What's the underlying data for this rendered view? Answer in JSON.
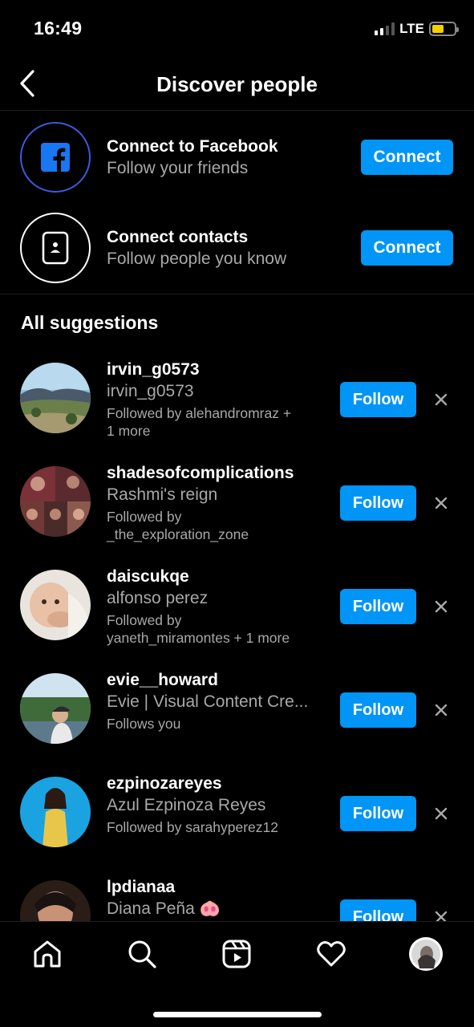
{
  "status_bar": {
    "time": "16:49",
    "network": "LTE",
    "battery_color": "#f5d000"
  },
  "header": {
    "title": "Discover people"
  },
  "connect": [
    {
      "title": "Connect to Facebook",
      "subtitle": "Follow your friends",
      "button": "Connect",
      "icon": "facebook-icon"
    },
    {
      "title": "Connect contacts",
      "subtitle": "Follow people you know",
      "button": "Connect",
      "icon": "contact-card-icon"
    }
  ],
  "section_title": "All suggestions",
  "suggestions": [
    {
      "username": "irvin_g0573",
      "name": "irvin_g0573",
      "followed_line1": "Followed by alehandromraz +",
      "followed_line2": "1 more",
      "button": "Follow"
    },
    {
      "username": "shadesofcomplications",
      "name": "Rashmi's reign",
      "followed_line1": "Followed by",
      "followed_line2": "_the_exploration_zone",
      "button": "Follow"
    },
    {
      "username": "daiscukqe",
      "name": "alfonso perez",
      "followed_line1": "Followed by",
      "followed_line2": "yaneth_miramontes + 1 more",
      "button": "Follow"
    },
    {
      "username": "evie__howard",
      "name": "Evie | Visual Content Cre...",
      "followed_line1": "Follows you",
      "followed_line2": "",
      "button": "Follow"
    },
    {
      "username": "ezpinozareyes",
      "name": "Azul Ezpinoza Reyes",
      "followed_line1": "Followed by sarahyperez12",
      "followed_line2": "",
      "button": "Follow"
    },
    {
      "username": "lpdianaa",
      "name": "Diana Peña 🐽",
      "followed_line1": "",
      "followed_line2": "",
      "button": "Follow"
    }
  ],
  "accent_color": "#0095f6",
  "bottom_nav": [
    "home-icon",
    "search-icon",
    "reels-icon",
    "heart-icon",
    "profile-avatar"
  ]
}
